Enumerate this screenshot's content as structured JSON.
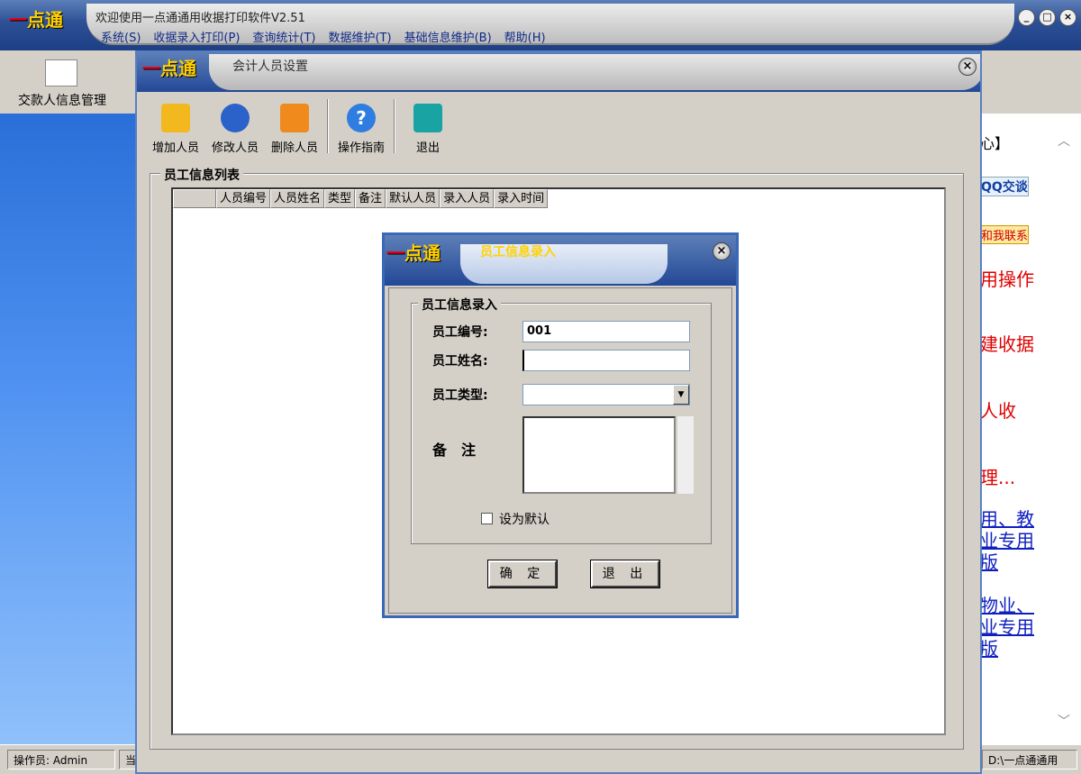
{
  "app": {
    "logo_dash": "一",
    "logo_text": "点通",
    "title": "欢迎使用一点通通用收据打印软件V2.51"
  },
  "menu": [
    "系统(S)",
    "收据录入打印(P)",
    "查询统计(T)",
    "数据维护(T)",
    "基础信息维护(B)",
    "帮助(H)"
  ],
  "window_buttons": {
    "minimize": "_",
    "restore": "□",
    "close": "×"
  },
  "left_nav": {
    "item_label": "交款人信息管理"
  },
  "right_pane": {
    "lines": [
      "心】",
      "QQ交谈",
      "和我联系",
      "用操作",
      "建收据",
      "人收",
      "理...",
      "用、教",
      "业专用",
      "版",
      "物业、",
      "业专用",
      "版"
    ]
  },
  "statusbar": {
    "operator": "操作员: Admin",
    "current": "当",
    "path": "D:\\一点通通用"
  },
  "child": {
    "logo_dash": "一",
    "logo_text": "点通",
    "title": "会计人员设置",
    "close": "×",
    "toolbar": [
      {
        "label": "增加人员",
        "icon": "add-person-icon",
        "color": "#f2b81e"
      },
      {
        "label": "修改人员",
        "icon": "edit-person-icon",
        "color": "#2b62c9"
      },
      {
        "label": "删除人员",
        "icon": "delete-person-icon",
        "color": "#f08a1d"
      },
      {
        "label": "操作指南",
        "icon": "help-icon",
        "color": "#2f7de0"
      },
      {
        "label": "退出",
        "icon": "exit-door-icon",
        "color": "#1aa3a3"
      }
    ],
    "group_label": "员工信息列表",
    "columns": [
      "",
      "人员编号",
      "人员姓名",
      "类型",
      "备注",
      "默认人员",
      "录入人员",
      "录入时间"
    ]
  },
  "dialog": {
    "logo_dash": "一",
    "logo_text": "点通",
    "title": "员工信息录入",
    "close": "×",
    "group_label": "员工信息录入",
    "id_label": "员工编号:",
    "id_value": "001",
    "name_label": "员工姓名:",
    "name_value": "",
    "type_label": "员工类型:",
    "type_value": "",
    "note_label": "备　注",
    "note_value": "",
    "default_label": "设为默认",
    "default_checked": false,
    "ok": "确 定",
    "cancel": "退 出"
  }
}
